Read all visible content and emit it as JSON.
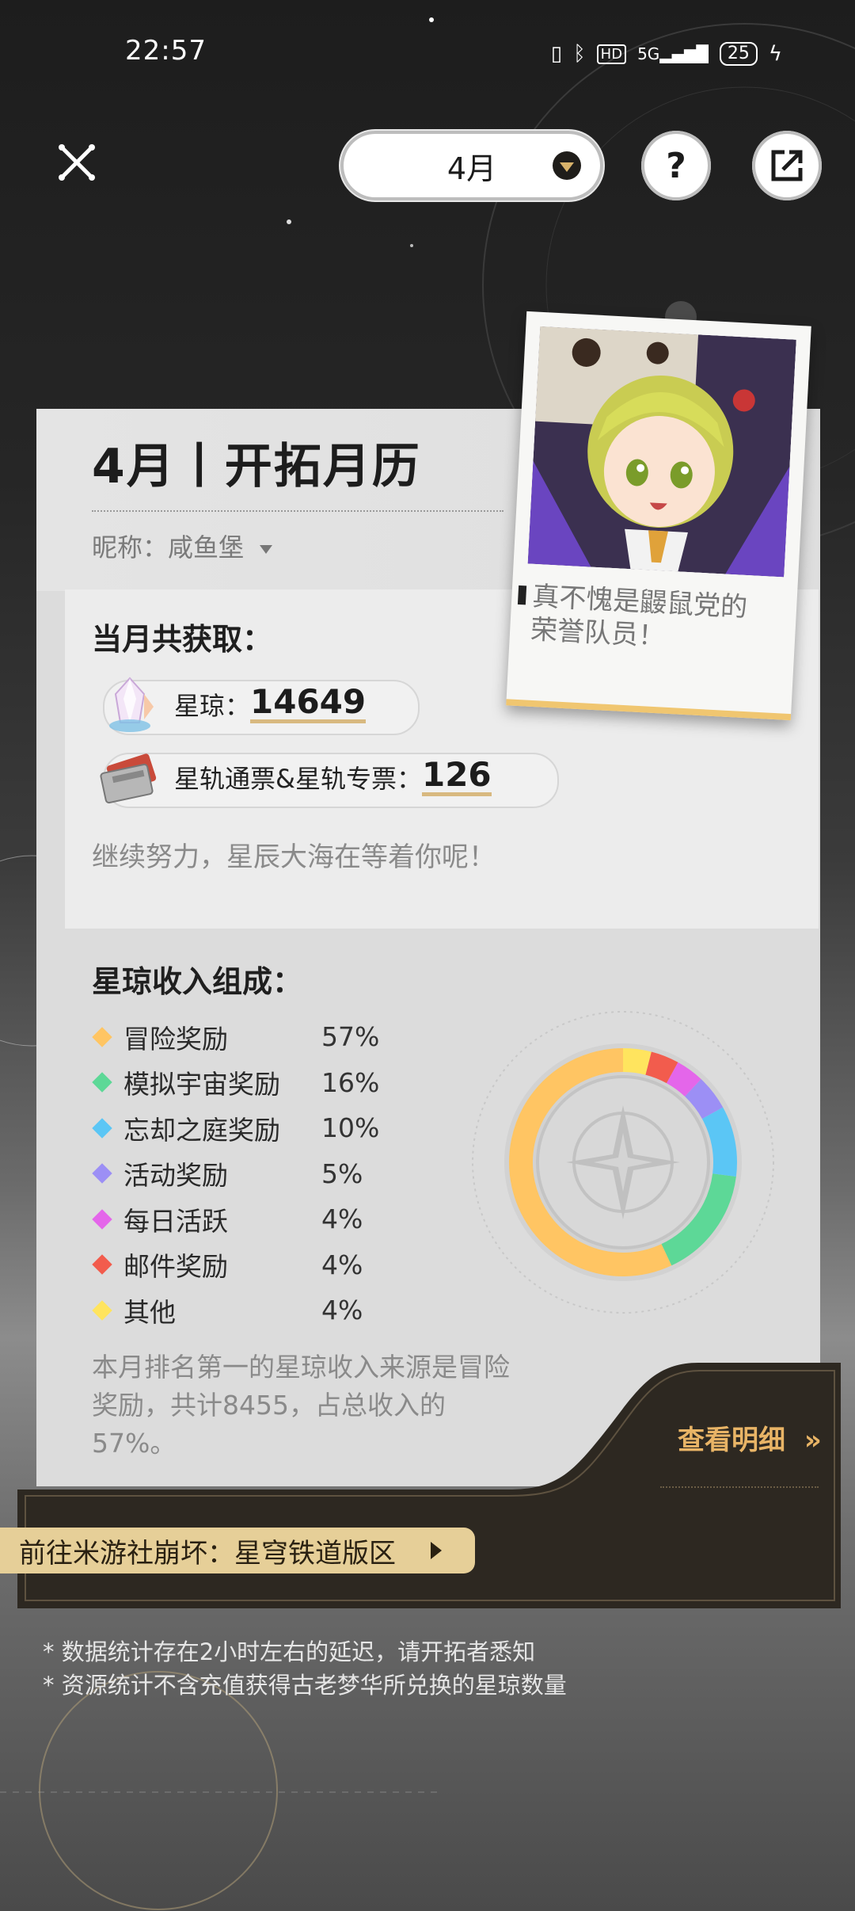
{
  "status_bar": {
    "time": "22:57",
    "icons": [
      "vibrate-icon",
      "bluetooth-icon",
      "hd-icon",
      "signal-5g-icon"
    ],
    "hd_label": "HD",
    "network_label": "5G",
    "battery_level": "25"
  },
  "header": {
    "month_selector_value": "4月",
    "help_label": "?"
  },
  "card": {
    "title": "4月丨开拓月历",
    "nickname": "昵称：咸鱼堡",
    "total_heading": "当月共获取：",
    "stellar_jade_label": "星琼：",
    "stellar_jade_value": "14649",
    "pass_label": "星轨通票&星轨专票：",
    "pass_value": "126",
    "encouragement": "继续努力，星辰大海在等着你呢！",
    "composition_heading": "星琼收入组成：",
    "summary": "本月排名第一的星琼收入来源是冒险奖励，共计8455，占总收入的57%。",
    "view_details": "查看明细",
    "view_details_arrow": "»"
  },
  "photo_card": {
    "quote": "真不愧是鼹鼠党的荣誉队员！"
  },
  "income_breakdown": [
    {
      "name": "冒险奖励",
      "percent_label": "57%",
      "value": 57,
      "color": "#ffc563"
    },
    {
      "name": "模拟宇宙奖励",
      "percent_label": "16%",
      "value": 16,
      "color": "#5dd897"
    },
    {
      "name": "忘却之庭奖励",
      "percent_label": "10%",
      "value": 10,
      "color": "#5bc6f5"
    },
    {
      "name": "活动奖励",
      "percent_label": "5%",
      "value": 5,
      "color": "#9c8ff5"
    },
    {
      "name": "每日活跃",
      "percent_label": "4%",
      "value": 4,
      "color": "#e466ea"
    },
    {
      "name": "邮件奖励",
      "percent_label": "4%",
      "value": 4,
      "color": "#f25c4d"
    },
    {
      "name": "其他",
      "percent_label": "4%",
      "value": 4,
      "color": "#ffe45e"
    }
  ],
  "community_link": "前往米游社崩坏：星穹铁道版区",
  "footnotes": [
    "* 数据统计存在2小时左右的延迟，请开拓者悉知",
    "* 资源统计不含充值获得古老梦华所兑换的星琼数量"
  ]
}
